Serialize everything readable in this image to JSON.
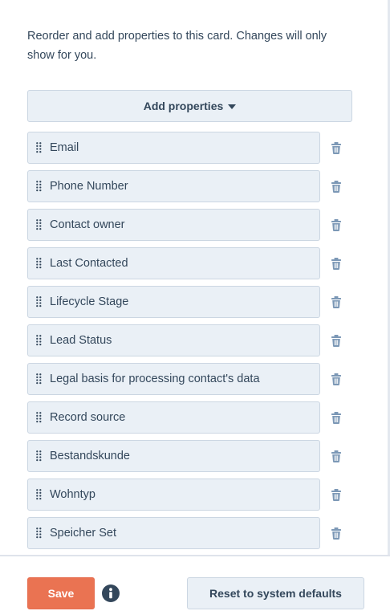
{
  "description": "Reorder and add properties to this card. Changes will only show for you.",
  "add_properties": {
    "label": "Add properties"
  },
  "properties": [
    {
      "label": "Email"
    },
    {
      "label": "Phone Number"
    },
    {
      "label": "Contact owner"
    },
    {
      "label": "Last Contacted"
    },
    {
      "label": "Lifecycle Stage"
    },
    {
      "label": "Lead Status"
    },
    {
      "label": "Legal basis for processing contact's data"
    },
    {
      "label": "Record source"
    },
    {
      "label": "Bestandskunde"
    },
    {
      "label": "Wohntyp"
    },
    {
      "label": "Speicher Set"
    }
  ],
  "footer": {
    "save_label": "Save",
    "reset_label": "Reset to system defaults"
  },
  "icons": {
    "drag": "drag-handle-icon",
    "delete": "trash-icon",
    "info": "info-icon",
    "dropdown": "caret-down-icon"
  },
  "colors": {
    "text": "#33475b",
    "accent_save": "#ea7352",
    "button_bg": "#eaf0f6",
    "border": "#cbd6e2",
    "icon": "#7c98b6"
  }
}
